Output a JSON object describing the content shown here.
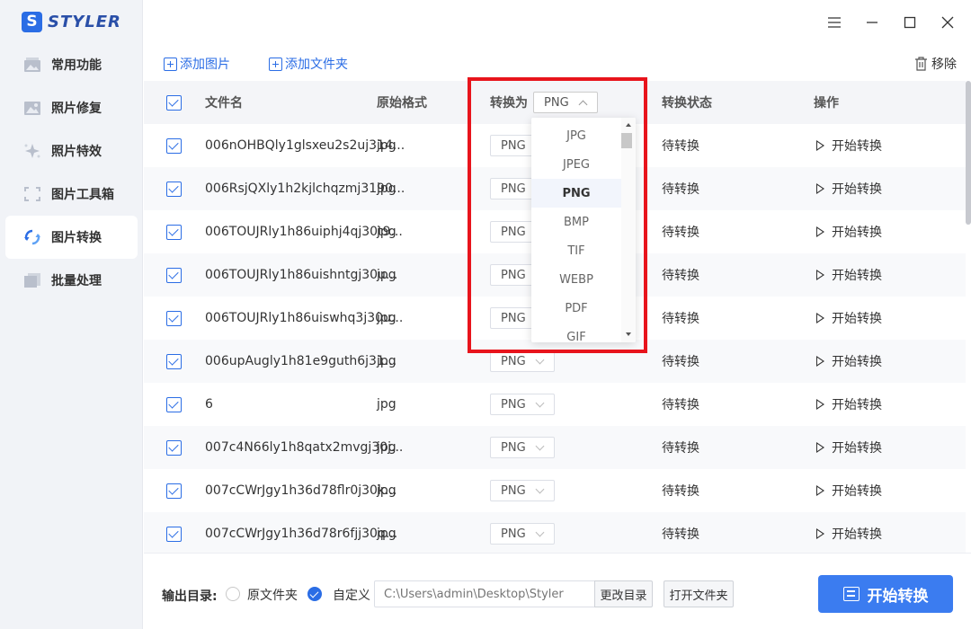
{
  "app": {
    "logo_letter": "S",
    "name": "STYLER"
  },
  "sidebar": {
    "items": [
      {
        "label": "常用功能",
        "icon": "image-stack-icon",
        "active": false
      },
      {
        "label": "照片修复",
        "icon": "photo-icon",
        "active": false
      },
      {
        "label": "照片特效",
        "icon": "sparkle-icon",
        "active": false
      },
      {
        "label": "图片工具箱",
        "icon": "crop-icon",
        "active": false
      },
      {
        "label": "图片转换",
        "icon": "convert-icon",
        "active": true
      },
      {
        "label": "批量处理",
        "icon": "layers-icon",
        "active": false
      }
    ]
  },
  "toolbar": {
    "add_image": "添加图片",
    "add_folder": "添加文件夹",
    "remove": "移除"
  },
  "table": {
    "headers": {
      "filename": "文件名",
      "orig_format": "原始格式",
      "convert_to": "转换为",
      "status": "转换状态",
      "action": "操作"
    },
    "header_format": "PNG",
    "rows": [
      {
        "name": "006nOHBQly1glsxeu2s2uj314...",
        "fmt": "jpg",
        "target": "PNG",
        "status": "待转换",
        "action": "开始转换"
      },
      {
        "name": "006RsjQXly1h2kjlchqzmj3190...",
        "fmt": "jpg",
        "target": "PNG",
        "status": "待转换",
        "action": "开始转换"
      },
      {
        "name": "006TOUJRly1h86uiphj4qj30t9...",
        "fmt": "jpg",
        "target": "PNG",
        "status": "待转换",
        "action": "开始转换"
      },
      {
        "name": "006TOUJRly1h86uishntgj30u...",
        "fmt": "jpg",
        "target": "PNG",
        "status": "待转换",
        "action": "开始转换"
      },
      {
        "name": "006TOUJRly1h86uiswhq3j30u...",
        "fmt": "jpg",
        "target": "PNG",
        "status": "待转换",
        "action": "开始转换"
      },
      {
        "name": "006upAugly1h81e9guth6j31...",
        "fmt": "jpg",
        "target": "PNG",
        "status": "待转换",
        "action": "开始转换"
      },
      {
        "name": "6",
        "fmt": "jpg",
        "target": "PNG",
        "status": "待转换",
        "action": "开始转换"
      },
      {
        "name": "007c4N66ly1h8qatx2mvgj30j...",
        "fmt": "jpg",
        "target": "PNG",
        "status": "待转换",
        "action": "开始转换"
      },
      {
        "name": "007cCWrJgy1h36d78flr0j30k...",
        "fmt": "jpg",
        "target": "PNG",
        "status": "待转换",
        "action": "开始转换"
      },
      {
        "name": "007cCWrJgy1h36d78r6fjj30q...",
        "fmt": "jpg",
        "target": "PNG",
        "status": "待转换",
        "action": "开始转换"
      }
    ]
  },
  "dropdown": {
    "options": [
      "JPG",
      "JPEG",
      "PNG",
      "BMP",
      "TIF",
      "WEBP",
      "PDF",
      "GIF"
    ],
    "selected": "PNG"
  },
  "footer": {
    "output_label": "输出目录:",
    "option_original": "原文件夹",
    "option_custom": "自定义",
    "selected_option": "自定义",
    "path_placeholder": "C:\\Users\\admin\\Desktop\\Styler",
    "change_dir": "更改目录",
    "open_folder": "打开文件夹",
    "start_all": "开始转换"
  },
  "colors": {
    "accent": "#2b6de5",
    "highlight": "#e8141c",
    "sidebar_bg": "#f1f3f7"
  }
}
